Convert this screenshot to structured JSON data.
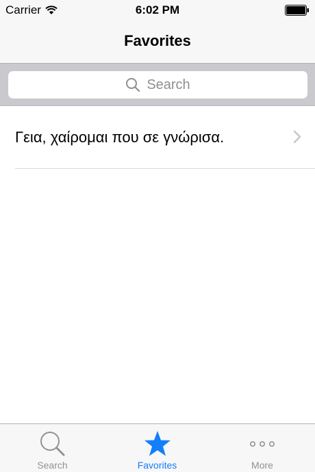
{
  "status_bar": {
    "carrier": "Carrier",
    "time": "6:02 PM"
  },
  "nav": {
    "title": "Favorites"
  },
  "search": {
    "placeholder": "Search"
  },
  "favorites": [
    {
      "text": "Γεια, χαίρομαι που σε γνώρισα."
    }
  ],
  "tabs": [
    {
      "label": "Search",
      "icon": "magnifier-icon",
      "active": false
    },
    {
      "label": "Favorites",
      "icon": "star-icon",
      "active": true
    },
    {
      "label": "More",
      "icon": "more-dots-icon",
      "active": false
    }
  ],
  "colors": {
    "accent": "#147efb",
    "inactive": "#929292",
    "bar_background": "#f7f7f7",
    "search_background": "#c9c9ce"
  }
}
